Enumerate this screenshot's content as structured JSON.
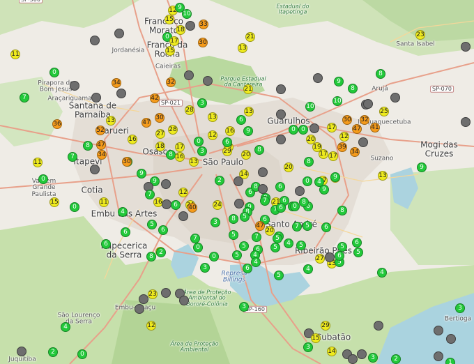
{
  "map": {
    "labels": [
      {
        "text": "Francisco Morato",
        "kind": "city"
      },
      {
        "text": "Franco da Rocha",
        "kind": "city"
      },
      {
        "text": "Jordanésia",
        "kind": "town"
      },
      {
        "text": "Caieiras",
        "kind": "town"
      },
      {
        "text": "Pirapora do Bom Jesus",
        "kind": "town"
      },
      {
        "text": "Araçariguama",
        "kind": "town"
      },
      {
        "text": "Santana de Parnaíba",
        "kind": "city"
      },
      {
        "text": "Barueri",
        "kind": "city"
      },
      {
        "text": "Osasco",
        "kind": "city"
      },
      {
        "text": "Itapevi",
        "kind": "city"
      },
      {
        "text": "São Paulo",
        "kind": "city"
      },
      {
        "text": "Guarulhos",
        "kind": "city"
      },
      {
        "text": "Arujá",
        "kind": "town"
      },
      {
        "text": "Santa Isabel",
        "kind": "town"
      },
      {
        "text": "Itaquaquecetuba",
        "kind": "town"
      },
      {
        "text": "Mogi das Cruzes",
        "kind": "city"
      },
      {
        "text": "Suzano",
        "kind": "town"
      },
      {
        "text": "Vargem Grande Paulista",
        "kind": "town"
      },
      {
        "text": "Cotia",
        "kind": "city"
      },
      {
        "text": "Embu das Artes",
        "kind": "city"
      },
      {
        "text": "Itapecerica da Serra",
        "kind": "city"
      },
      {
        "text": "Santo André",
        "kind": "city"
      },
      {
        "text": "Ribeirão Pires",
        "kind": "city"
      },
      {
        "text": "Embu-Guaçu",
        "kind": "town"
      },
      {
        "text": "São Lourenço da Serra",
        "kind": "town"
      },
      {
        "text": "Juquitiba",
        "kind": "town"
      },
      {
        "text": "Cubatão",
        "kind": "city"
      },
      {
        "text": "Bertioga",
        "kind": "town"
      },
      {
        "text": "Parque Estadual da Cantareira",
        "kind": "park"
      },
      {
        "text": "Estadual do Itapetinga",
        "kind": "park"
      },
      {
        "text": "Área de Proteção Ambiental do Bororé-Colônia",
        "kind": "park"
      },
      {
        "text": "Área de Proteção Ambiental",
        "kind": "park"
      },
      {
        "text": "Represa Billings",
        "kind": "water"
      },
      {
        "text": "SP-021",
        "kind": "road"
      },
      {
        "text": "SP-070",
        "kind": "road"
      },
      {
        "text": "SP-160",
        "kind": "road"
      },
      {
        "text": "SP-300",
        "kind": "road"
      }
    ],
    "markers": [
      {
        "v": "12",
        "c": "yellow"
      },
      {
        "v": "9",
        "c": "green"
      },
      {
        "v": "10",
        "c": "green"
      },
      {
        "v": "15",
        "c": "yellow"
      },
      {
        "v": "18",
        "c": "yellow"
      },
      {
        "v": "",
        "c": "gray"
      },
      {
        "v": "33",
        "c": "orange"
      },
      {
        "v": "0",
        "c": "green"
      },
      {
        "v": "17",
        "c": "yellow"
      },
      {
        "v": "15",
        "c": "yellow"
      },
      {
        "v": "30",
        "c": "orange"
      },
      {
        "v": "",
        "c": "gray"
      },
      {
        "v": "",
        "c": "gray"
      },
      {
        "v": "21",
        "c": "yellow"
      },
      {
        "v": "13",
        "c": "yellow"
      },
      {
        "v": "23",
        "c": "yellow"
      },
      {
        "v": "11",
        "c": "yellow"
      },
      {
        "v": "",
        "c": "gray"
      },
      {
        "v": "0",
        "c": "green"
      },
      {
        "v": "",
        "c": "gray"
      },
      {
        "v": "34",
        "c": "orange"
      },
      {
        "v": "32",
        "c": "orange"
      },
      {
        "v": "",
        "c": "gray"
      },
      {
        "v": "",
        "c": "gray"
      },
      {
        "v": "21",
        "c": "yellow"
      },
      {
        "v": "",
        "c": "gray"
      },
      {
        "v": "9",
        "c": "green"
      },
      {
        "v": "8",
        "c": "green"
      },
      {
        "v": "8",
        "c": "green"
      },
      {
        "v": "7",
        "c": "green"
      },
      {
        "v": "",
        "c": "gray"
      },
      {
        "v": "",
        "c": "gray"
      },
      {
        "v": "42",
        "c": "orange"
      },
      {
        "v": "3",
        "c": "green"
      },
      {
        "v": "13",
        "c": "yellow"
      },
      {
        "v": "",
        "c": "gray"
      },
      {
        "v": "10",
        "c": "green"
      },
      {
        "v": "10",
        "c": "green"
      },
      {
        "v": "",
        "c": "gray"
      },
      {
        "v": "",
        "c": "gray"
      },
      {
        "v": "",
        "c": "gray"
      },
      {
        "v": "25",
        "c": "yellow"
      },
      {
        "v": "36",
        "c": "orange"
      },
      {
        "v": "13",
        "c": "yellow"
      },
      {
        "v": "30",
        "c": "orange"
      },
      {
        "v": "28",
        "c": "yellow"
      },
      {
        "v": "13",
        "c": "yellow"
      },
      {
        "v": "6",
        "c": "green"
      },
      {
        "v": "16",
        "c": "yellow"
      },
      {
        "v": "9",
        "c": "green"
      },
      {
        "v": "",
        "c": "gray"
      },
      {
        "v": "0",
        "c": "green"
      },
      {
        "v": "0",
        "c": "green"
      },
      {
        "v": "",
        "c": "gray"
      },
      {
        "v": "17",
        "c": "yellow"
      },
      {
        "v": "30",
        "c": "orange"
      },
      {
        "v": "32",
        "c": "orange"
      },
      {
        "v": "47",
        "c": "orange"
      },
      {
        "v": "41",
        "c": "orange"
      },
      {
        "v": "",
        "c": "gray"
      },
      {
        "v": "52",
        "c": "orange"
      },
      {
        "v": "47",
        "c": "orange"
      },
      {
        "v": "27",
        "c": "yellow"
      },
      {
        "v": "28",
        "c": "yellow"
      },
      {
        "v": "8",
        "c": "green"
      },
      {
        "v": "47",
        "c": "orange"
      },
      {
        "v": "16",
        "c": "yellow"
      },
      {
        "v": "18",
        "c": "yellow"
      },
      {
        "v": "17",
        "c": "yellow"
      },
      {
        "v": "0",
        "c": "green"
      },
      {
        "v": "12",
        "c": "yellow"
      },
      {
        "v": "17",
        "c": "yellow"
      },
      {
        "v": "29",
        "c": "yellow"
      },
      {
        "v": "20",
        "c": "yellow"
      },
      {
        "v": "",
        "c": "gray"
      },
      {
        "v": "20",
        "c": "yellow"
      },
      {
        "v": "19",
        "c": "yellow"
      },
      {
        "v": "39",
        "c": "orange"
      },
      {
        "v": "12",
        "c": "yellow"
      },
      {
        "v": "34",
        "c": "orange"
      },
      {
        "v": "",
        "c": "gray"
      },
      {
        "v": "7",
        "c": "green"
      },
      {
        "v": "34",
        "c": "orange"
      },
      {
        "v": "8",
        "c": "green"
      },
      {
        "v": "16",
        "c": "yellow"
      },
      {
        "v": "3",
        "c": "green"
      },
      {
        "v": "6",
        "c": "green"
      },
      {
        "v": "13",
        "c": "yellow"
      },
      {
        "v": "8",
        "c": "green"
      },
      {
        "v": "11",
        "c": "yellow"
      },
      {
        "v": "17",
        "c": "yellow"
      },
      {
        "v": "17",
        "c": "yellow"
      },
      {
        "v": "9",
        "c": "green"
      },
      {
        "v": "13",
        "c": "yellow"
      },
      {
        "v": "0",
        "c": "green"
      },
      {
        "v": "30",
        "c": "orange"
      },
      {
        "v": "9",
        "c": "green"
      },
      {
        "v": "14",
        "c": "yellow"
      },
      {
        "v": "20",
        "c": "yellow"
      },
      {
        "v": "",
        "c": "gray"
      },
      {
        "v": "8",
        "c": "green"
      },
      {
        "v": "17",
        "c": "yellow"
      },
      {
        "v": "13",
        "c": "yellow"
      },
      {
        "v": "0",
        "c": "green"
      },
      {
        "v": "15",
        "c": "yellow"
      },
      {
        "v": "0",
        "c": "green"
      },
      {
        "v": "11",
        "c": "yellow"
      },
      {
        "v": "",
        "c": "gray"
      },
      {
        "v": "9",
        "c": "green"
      },
      {
        "v": "",
        "c": "gray"
      },
      {
        "v": "7",
        "c": "green"
      },
      {
        "v": "",
        "c": "gray"
      },
      {
        "v": "12",
        "c": "yellow"
      },
      {
        "v": "2",
        "c": "green"
      },
      {
        "v": "",
        "c": "gray"
      },
      {
        "v": "6",
        "c": "green"
      },
      {
        "v": "8",
        "c": "green"
      },
      {
        "v": "",
        "c": "gray"
      },
      {
        "v": "9",
        "c": "green"
      },
      {
        "v": "6",
        "c": "green"
      },
      {
        "v": "",
        "c": "gray"
      },
      {
        "v": "0",
        "c": "green"
      },
      {
        "v": "4",
        "c": "green"
      },
      {
        "v": "9",
        "c": "green"
      },
      {
        "v": "6",
        "c": "green"
      },
      {
        "v": "7",
        "c": "green"
      },
      {
        "v": "8",
        "c": "green"
      },
      {
        "v": "9",
        "c": "green"
      },
      {
        "v": "8",
        "c": "green"
      },
      {
        "v": "4",
        "c": "green"
      },
      {
        "v": "16",
        "c": "yellow"
      },
      {
        "v": "",
        "c": "gray"
      },
      {
        "v": "6",
        "c": "green"
      },
      {
        "v": "24",
        "c": "yellow"
      },
      {
        "v": "40",
        "c": "orange"
      },
      {
        "v": "",
        "c": "gray"
      },
      {
        "v": "24",
        "c": "yellow"
      },
      {
        "v": "",
        "c": "gray"
      },
      {
        "v": "9",
        "c": "green"
      },
      {
        "v": "21",
        "c": "yellow"
      },
      {
        "v": "6",
        "c": "green"
      },
      {
        "v": "7",
        "c": "green"
      },
      {
        "v": "6",
        "c": "green"
      },
      {
        "v": "8",
        "c": "green"
      },
      {
        "v": "8",
        "c": "green"
      },
      {
        "v": "7",
        "c": "green"
      },
      {
        "v": "5",
        "c": "green"
      },
      {
        "v": "6",
        "c": "green"
      },
      {
        "v": "6",
        "c": "green"
      },
      {
        "v": "0",
        "c": "green"
      },
      {
        "v": "8",
        "c": "green"
      },
      {
        "v": "8",
        "c": "green"
      },
      {
        "v": "6",
        "c": "green"
      },
      {
        "v": "5",
        "c": "green"
      },
      {
        "v": "6",
        "c": "green"
      },
      {
        "v": "6",
        "c": "green"
      },
      {
        "v": "15",
        "c": "yellow"
      },
      {
        "v": "7",
        "c": "green"
      },
      {
        "v": "0",
        "c": "green"
      },
      {
        "v": "3",
        "c": "green"
      },
      {
        "v": "5",
        "c": "green"
      },
      {
        "v": "47",
        "c": "orange"
      },
      {
        "v": "20",
        "c": "yellow"
      },
      {
        "v": "6",
        "c": "green"
      },
      {
        "v": "4",
        "c": "green"
      },
      {
        "v": "5",
        "c": "green"
      },
      {
        "v": "6",
        "c": "green"
      },
      {
        "v": "5",
        "c": "green"
      },
      {
        "v": "5",
        "c": "green"
      },
      {
        "v": "7",
        "c": "green"
      },
      {
        "v": "5",
        "c": "green"
      },
      {
        "v": "5",
        "c": "green"
      },
      {
        "v": "6",
        "c": "green"
      },
      {
        "v": "5",
        "c": "green"
      },
      {
        "v": "8",
        "c": "green"
      },
      {
        "v": "2",
        "c": "green"
      },
      {
        "v": "0",
        "c": "green"
      },
      {
        "v": "5",
        "c": "green"
      },
      {
        "v": "4",
        "c": "green"
      },
      {
        "v": "5",
        "c": "green"
      },
      {
        "v": "27",
        "c": "yellow"
      },
      {
        "v": "13",
        "c": "yellow"
      },
      {
        "v": "",
        "c": "gray"
      },
      {
        "v": "5",
        "c": "green"
      },
      {
        "v": "4",
        "c": "green"
      },
      {
        "v": "6",
        "c": "green"
      },
      {
        "v": "4",
        "c": "green"
      },
      {
        "v": "3",
        "c": "green"
      },
      {
        "v": "6",
        "c": "green"
      },
      {
        "v": "4",
        "c": "green"
      },
      {
        "v": "5",
        "c": "green"
      },
      {
        "v": "23",
        "c": "yellow"
      },
      {
        "v": "",
        "c": "gray"
      },
      {
        "v": "",
        "c": "gray"
      },
      {
        "v": "",
        "c": "gray"
      },
      {
        "v": "",
        "c": "gray"
      },
      {
        "v": "",
        "c": "gray"
      },
      {
        "v": "3",
        "c": "green"
      },
      {
        "v": "4",
        "c": "green"
      },
      {
        "v": "12",
        "c": "yellow"
      },
      {
        "v": "",
        "c": "gray"
      },
      {
        "v": "",
        "c": "gray"
      },
      {
        "v": "29",
        "c": "yellow"
      },
      {
        "v": "15",
        "c": "yellow"
      },
      {
        "v": "3",
        "c": "green"
      },
      {
        "v": "",
        "c": "gray"
      },
      {
        "v": "",
        "c": "gray"
      },
      {
        "v": "",
        "c": "gray"
      },
      {
        "v": "2",
        "c": "green"
      },
      {
        "v": "0",
        "c": "green"
      },
      {
        "v": "3",
        "c": "green"
      },
      {
        "v": "14",
        "c": "yellow"
      },
      {
        "v": "",
        "c": "gray"
      },
      {
        "v": "",
        "c": "gray"
      },
      {
        "v": "",
        "c": "gray"
      },
      {
        "v": "3",
        "c": "green"
      },
      {
        "v": "",
        "c": "gray"
      },
      {
        "v": "1",
        "c": "green"
      },
      {
        "v": "2",
        "c": "green"
      },
      {
        "v": "",
        "c": "gray"
      },
      {
        "v": "",
        "c": "gray"
      },
      {
        "v": "",
        "c": "gray"
      },
      {
        "v": "",
        "c": "gray"
      }
    ]
  }
}
